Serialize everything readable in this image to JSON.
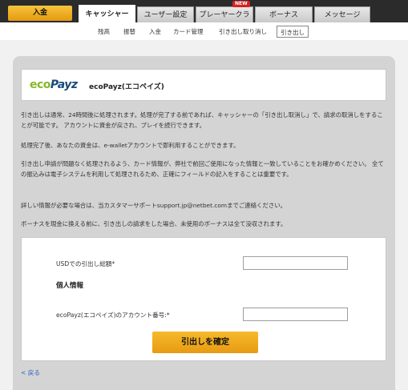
{
  "topnav": {
    "deposit_label": "入金",
    "tabs": [
      {
        "label": "キャッシャー"
      },
      {
        "label": "ユーザー設定"
      },
      {
        "label": "プレーヤークラブ"
      },
      {
        "label": "ボーナス"
      },
      {
        "label": "メッセージ"
      }
    ],
    "new_badge": "NEW"
  },
  "subnav": {
    "items": [
      {
        "label": "残高"
      },
      {
        "label": "振替"
      },
      {
        "label": "入金"
      },
      {
        "label": "カード管理"
      },
      {
        "label": "引き出し取り消し"
      },
      {
        "label": "引き出し"
      }
    ]
  },
  "brand": {
    "logo_eco": "eco",
    "logo_payz": "Payz",
    "title": "ecoPayz(エコペイズ)"
  },
  "info": {
    "p1": "引き出しは通常、24時間後に処理されます。処理が完了する前であれば、キャッシャーの「引き出し取消し」で、請求の取消しをすることが可能です。 アカウントに資金が戻され、プレイを続行できます。",
    "p2": "処理完了後、あなたの資金は、e-walletアカウントで即利用することができます。",
    "p3": "引き出し申請が問題なく処理されるよう、カード情報が、弊社で前回ご使用になった情報と一致していることをお確かめください。 全ての振込みは電子システムを利用して処理されるため、正確にフィールドの記入をすることは重要です。",
    "p4": "詳しい情報が必要な場合は、当カスタマーサポートsupport.jp@netbet.comまでご連絡ください。",
    "p5": "ボーナスを現金に換える前に、引き出しの請求をした場合、未使用のボーナスは全て没収されます。"
  },
  "form": {
    "amount_label": "USDでの引出し総額*",
    "amount_value": "",
    "section_title": "個人情報",
    "account_label": "ecoPayz(エコペイズ)のアカウント番号:*",
    "account_value": "",
    "confirm_label": "引出しを確定"
  },
  "back_label": "< 戻る",
  "colors": {
    "accent": "#f0a820",
    "logo_green": "#86b82a",
    "logo_blue": "#184a7a",
    "link": "#2a5fbf"
  }
}
